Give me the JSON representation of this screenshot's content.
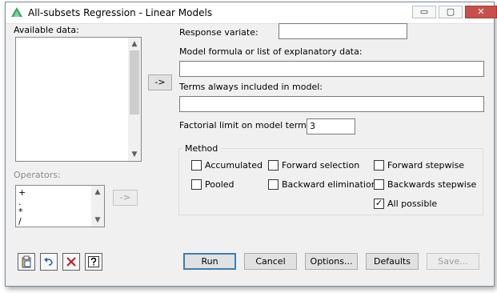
{
  "window": {
    "title": "All-subsets Regression - Linear Models",
    "controls": {
      "minimize": "▭",
      "maximize": "▢",
      "close": "✕"
    }
  },
  "left": {
    "available_data_label": "Available data:",
    "operators_label": "Operators:",
    "operators": [
      "+",
      ".",
      "*",
      "/"
    ],
    "transfer_button": "->",
    "operator_transfer_button": "->"
  },
  "form": {
    "response_variate_label": "Response variate:",
    "response_variate_value": "",
    "model_formula_label": "Model formula or list of explanatory data:",
    "model_formula_value": "",
    "terms_label": "Terms always included in model:",
    "terms_value": "",
    "factorial_label": "Factorial limit on model terms:",
    "factorial_value": "3"
  },
  "method": {
    "title": "Method",
    "options": {
      "accumulated": {
        "label": "Accumulated",
        "checked": false
      },
      "forward_selection": {
        "label": "Forward selection",
        "checked": false
      },
      "forward_stepwise": {
        "label": "Forward stepwise",
        "checked": false
      },
      "pooled": {
        "label": "Pooled",
        "checked": false
      },
      "backward_elimination": {
        "label": "Backward elimination",
        "checked": false
      },
      "backwards_stepwise": {
        "label": "Backwards stepwise",
        "checked": false
      },
      "all_possible": {
        "label": "All possible",
        "checked": true
      }
    },
    "check_glyph": "✓"
  },
  "buttons": {
    "run": "Run",
    "cancel": "Cancel",
    "options": "Options...",
    "defaults": "Defaults",
    "save": "Save..."
  },
  "icons": [
    "clipboard-icon",
    "undo-icon",
    "clear-icon",
    "help-icon"
  ],
  "colors": {
    "close": "#c7504b",
    "default_border": "#3c7fb1",
    "undo": "#1f5fbf",
    "clear": "#b22222"
  }
}
